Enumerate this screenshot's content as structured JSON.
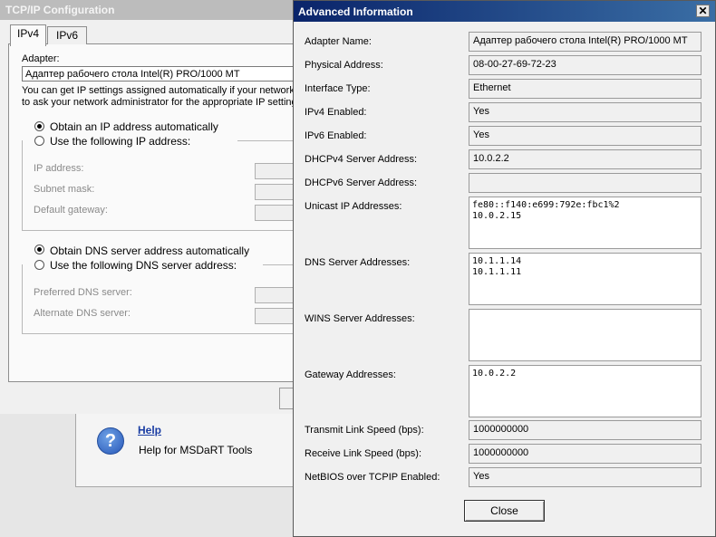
{
  "tcp": {
    "title": "TCP/IP Configuration",
    "tabs": [
      "IPv4",
      "IPv6"
    ],
    "adapter_label": "Adapter:",
    "adapter_value": "Адаптер рабочего стола Intel(R) PRO/1000 MT",
    "info_line1": "You can get IP settings assigned automatically if your network s",
    "info_line2": "to ask your network administrator for the appropriate IP settings.",
    "ip_auto": "Obtain an IP address automatically",
    "ip_manual": "Use the following IP address:",
    "ip_address": "IP address:",
    "subnet_mask": "Subnet mask:",
    "default_gateway": "Default gateway:",
    "dns_auto": "Obtain DNS server address automatically",
    "dns_manual": "Use the following DNS server address:",
    "preferred_dns": "Preferred DNS server:",
    "alternate_dns": "Alternate DNS server:"
  },
  "help": {
    "link": "Help",
    "description": "Help for MSDaRT Tools"
  },
  "advanced": {
    "title": "Advanced Information",
    "rows": [
      {
        "label": "Adapter Name:",
        "value": "Адаптер рабочего стола Intel(R) PRO/1000 MT"
      },
      {
        "label": "Physical Address:",
        "value": "08-00-27-69-72-23"
      },
      {
        "label": "Interface Type:",
        "value": "Ethernet"
      },
      {
        "label": "IPv4 Enabled:",
        "value": "Yes"
      },
      {
        "label": "IPv6 Enabled:",
        "value": "Yes"
      },
      {
        "label": "DHCPv4 Server Address:",
        "value": "10.0.2.2"
      },
      {
        "label": "DHCPv6 Server Address:",
        "value": ""
      }
    ],
    "unicast_label": "Unicast IP Addresses:",
    "unicast": [
      "fe80::f140:e699:792e:fbc1%2",
      "10.0.2.15"
    ],
    "dns_label": "DNS Server Addresses:",
    "dns": [
      "10.1.1.14",
      "10.1.1.11"
    ],
    "wins_label": "WINS Server Addresses:",
    "wins": [],
    "gateway_label": "Gateway Addresses:",
    "gateway": [
      "10.0.2.2"
    ],
    "tx_label": "Transmit Link Speed (bps):",
    "tx_value": "1000000000",
    "rx_label": "Receive Link Speed (bps):",
    "rx_value": "1000000000",
    "netbios_label": "NetBIOS over TCPIP Enabled:",
    "netbios_value": "Yes",
    "close_label": "Close"
  }
}
